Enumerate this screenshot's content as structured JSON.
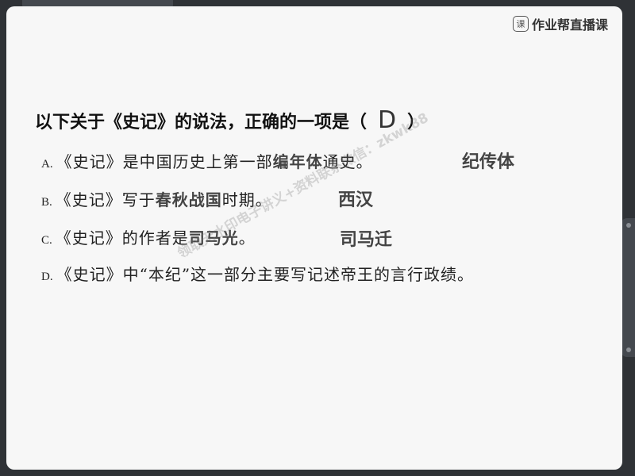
{
  "brand": {
    "icon_char": "课",
    "name": "作业帮直播课"
  },
  "question": {
    "stem_before": "以下关于《史记》的说法，正确的一项是（",
    "answer": "D",
    "stem_after": "）"
  },
  "options": [
    {
      "letter": "A.",
      "before": "《史记》是中国历史上第一部",
      "highlight": "编年体",
      "after": "通史。",
      "note": "纪传体"
    },
    {
      "letter": "B.",
      "before": "《史记》写于",
      "highlight": "春秋战国",
      "after": "时期。",
      "note": "西汉"
    },
    {
      "letter": "C.",
      "before": "《史记》的作者是",
      "highlight": "司马光",
      "after": "。",
      "note": "司马迁"
    },
    {
      "letter": "D.",
      "before": "《史记》中“本纪”这一部分主要写记述帝王的言行政绩。",
      "highlight": "",
      "after": "",
      "note": ""
    }
  ],
  "watermark": "领取无水印电子讲义+资料联系微信：zkwk88"
}
